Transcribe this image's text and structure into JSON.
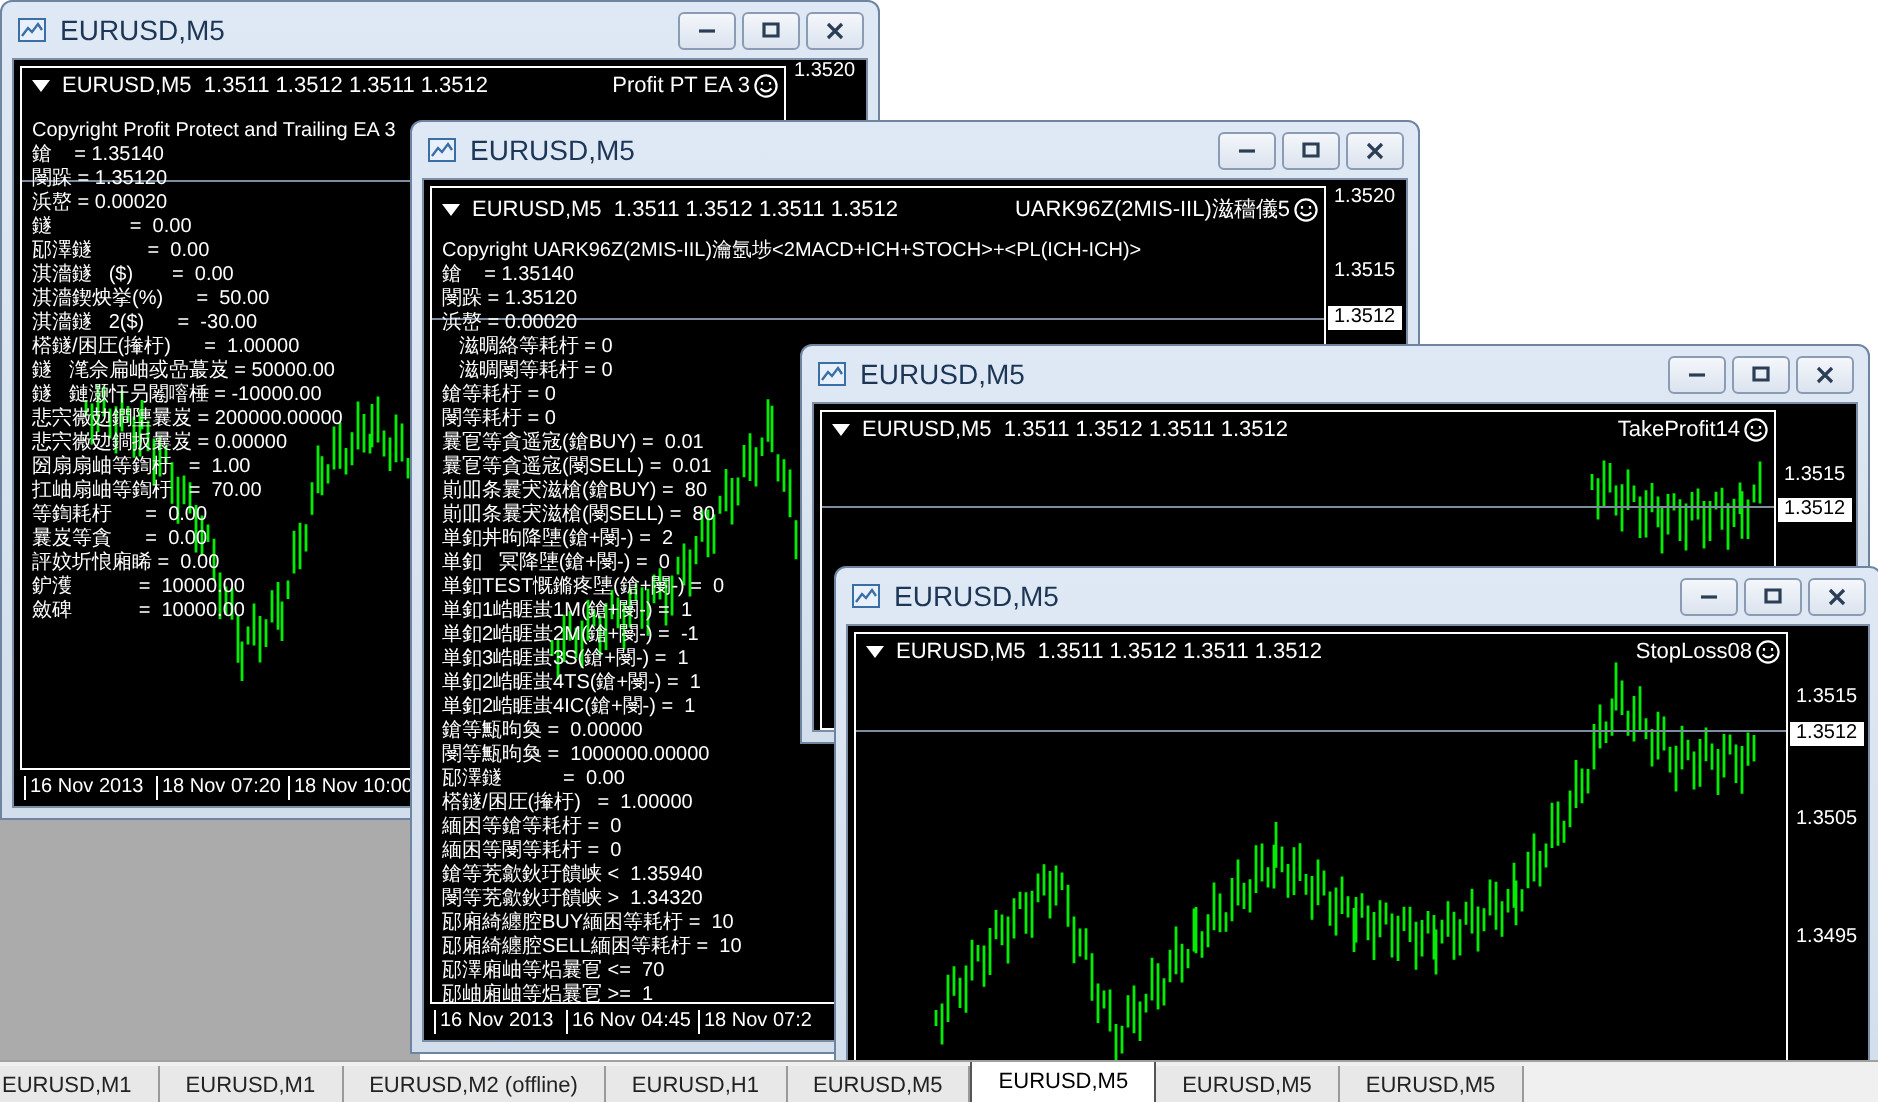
{
  "windows": [
    {
      "title": "EURUSD,M5",
      "symbol_line": "EURUSD,M5  1.3511 1.3512 1.3511 1.3512",
      "expert": "Profit PT EA 3",
      "price_labels": [
        {
          "text": "1.3520",
          "kind": "tick"
        }
      ],
      "info_lines": [
        "Copyright Profit Protect and Trailing EA 3",
        "鎗    = 1.35140",
        "閿跺 = 1.35120",
        "浜嶅 = 0.00020",
        "鐩              =  0.00",
        "邷澤鐩          =  0.00",
        "淇濇鐩   ($)       =  0.00",
        "淇濇鍥炴挙(%)      =  50.00",
        "淇濇鐩   2($)      =  -30.00",
        "榙鐩/困圧(撪杅)      =  1.00000",
        "鐩   滗佘扁岫㦯嵒蕞岌 = 50000.00",
        "鐩   鏈灏忓叧闂噾棰 = -10000.00",
        "悲宍嶶攰鐧塦曩岌 = 200000.00000",
        "悲宍嶶攰鐧扳曩岌 = 0.00000",
        "圀扇扇岫等鍧杅   =  1.00",
        "扛岫扇岫等鍧杅   =  70.00",
        "等鍧耗杅      =  0.00",
        "曩岌等貪      =  0.00",
        "評妏圻悢廂睎 =  0.00",
        "鈩濩            =  10000.00",
        "斂碑            =  10000.00"
      ],
      "time_labels": [
        "16 Nov 2013",
        "18 Nov 07:20",
        "18 Nov 10:00"
      ]
    },
    {
      "title": "EURUSD,M5",
      "symbol_line": "EURUSD,M5  1.3511 1.3512 1.3511 1.3512",
      "expert": "UARK96Z(2MIS-IIL)滋穡儀5",
      "price_labels": [
        {
          "text": "1.3520",
          "kind": "tick"
        },
        {
          "text": "1.3515",
          "kind": "tick"
        },
        {
          "text": "1.3512",
          "kind": "current"
        }
      ],
      "info_lines": [
        "Copyright UARK96Z(2MIS-IIL)瀹氬埗<2MACD+ICH+STOCH>+<PL(ICH-ICH)>",
        "鎗    = 1.35140",
        "閿跺 = 1.35120",
        "浜嶅 = 0.00020",
        "   滋晭絡等耗杅 = 0",
        "   滋晭閿等耗杅 = 0",
        "鎗等耗杅 = 0",
        "閿等耗杅 = 0",
        "曩冟等貪遥宼(鎗BUY) =  0.01",
        "曩冟等貪遥宼(閿SELL) =  0.01",
        "崱吅条曩宊滋槍(鎗BUY) =  80",
        "崱吅条曩宊滋槍(閿SELL) =  80",
        "単釦丼昫降塦(鎗+閿-) =  2",
        "単釦   冥降塦(鎗+閿-) =  0",
        "単釦TEST慨鏅疼塦(鎗+閿-) =  0",
        "単釦1峼睚蚩1M(鎗+閿-) =  1",
        "単釦2峼睚蚩2M(鎗+閿-) =  -1",
        "単釦3峼睚蚩3S(鎗+閿-) =  1",
        "単釦2峼睚蚩4TS(鎗+閿-) =  1",
        "単釦2峼睚蚩4IC(鎗+閿-) =  1",
        "鎗等甒昫奐 =  0.00000",
        "閿等甒昫奐 =  1000000.00000",
        "邷澤鐩           =  0.00",
        "榙鐩/困圧(撪杅)   =  1.00000",
        "緬困等鎗等耗杅 =  0",
        "緬困等閿等耗杅 =  0",
        "鎗等茺歙鈥玗饋峡 <  1.35940",
        "閿等茺歙鈥玗饋峡 >  1.34320",
        "邷廂綺纏腔BUY緬困等耗杅 =  10",
        "邷廂綺纏腔SELL緬困等耗杅 =  10",
        "邷澤廂岫等焒曩冟 <=  70",
        "邷岫廂岫等焒曩冟 >=  1"
      ],
      "time_labels": [
        "16 Nov 2013",
        "16 Nov 04:45",
        "18 Nov 07:2"
      ]
    },
    {
      "title": "EURUSD,M5",
      "symbol_line": "EURUSD,M5  1.3511 1.3512 1.3511 1.3512",
      "expert": "TakeProfit14",
      "price_labels": [
        {
          "text": "1.3515",
          "kind": "tick"
        },
        {
          "text": "1.3512",
          "kind": "current"
        }
      ]
    },
    {
      "title": "EURUSD,M5",
      "symbol_line": "EURUSD,M5  1.3511 1.3512 1.3511 1.3512",
      "expert": "StopLoss08",
      "price_labels": [
        {
          "text": "1.3515",
          "kind": "tick"
        },
        {
          "text": "1.3512",
          "kind": "current"
        },
        {
          "text": "1.3505",
          "kind": "tick"
        },
        {
          "text": "1.3495",
          "kind": "tick"
        }
      ]
    }
  ],
  "tabs": [
    {
      "label": "EURUSD,M1",
      "selected": false
    },
    {
      "label": "EURUSD,M1",
      "selected": false
    },
    {
      "label": "EURUSD,M2 (offline)",
      "selected": false
    },
    {
      "label": "EURUSD,H1",
      "selected": false
    },
    {
      "label": "EURUSD,M5",
      "selected": false
    },
    {
      "label": "EURUSD,M5",
      "selected": true
    },
    {
      "label": "EURUSD,M5",
      "selected": false
    },
    {
      "label": "EURUSD,M5",
      "selected": false
    }
  ]
}
